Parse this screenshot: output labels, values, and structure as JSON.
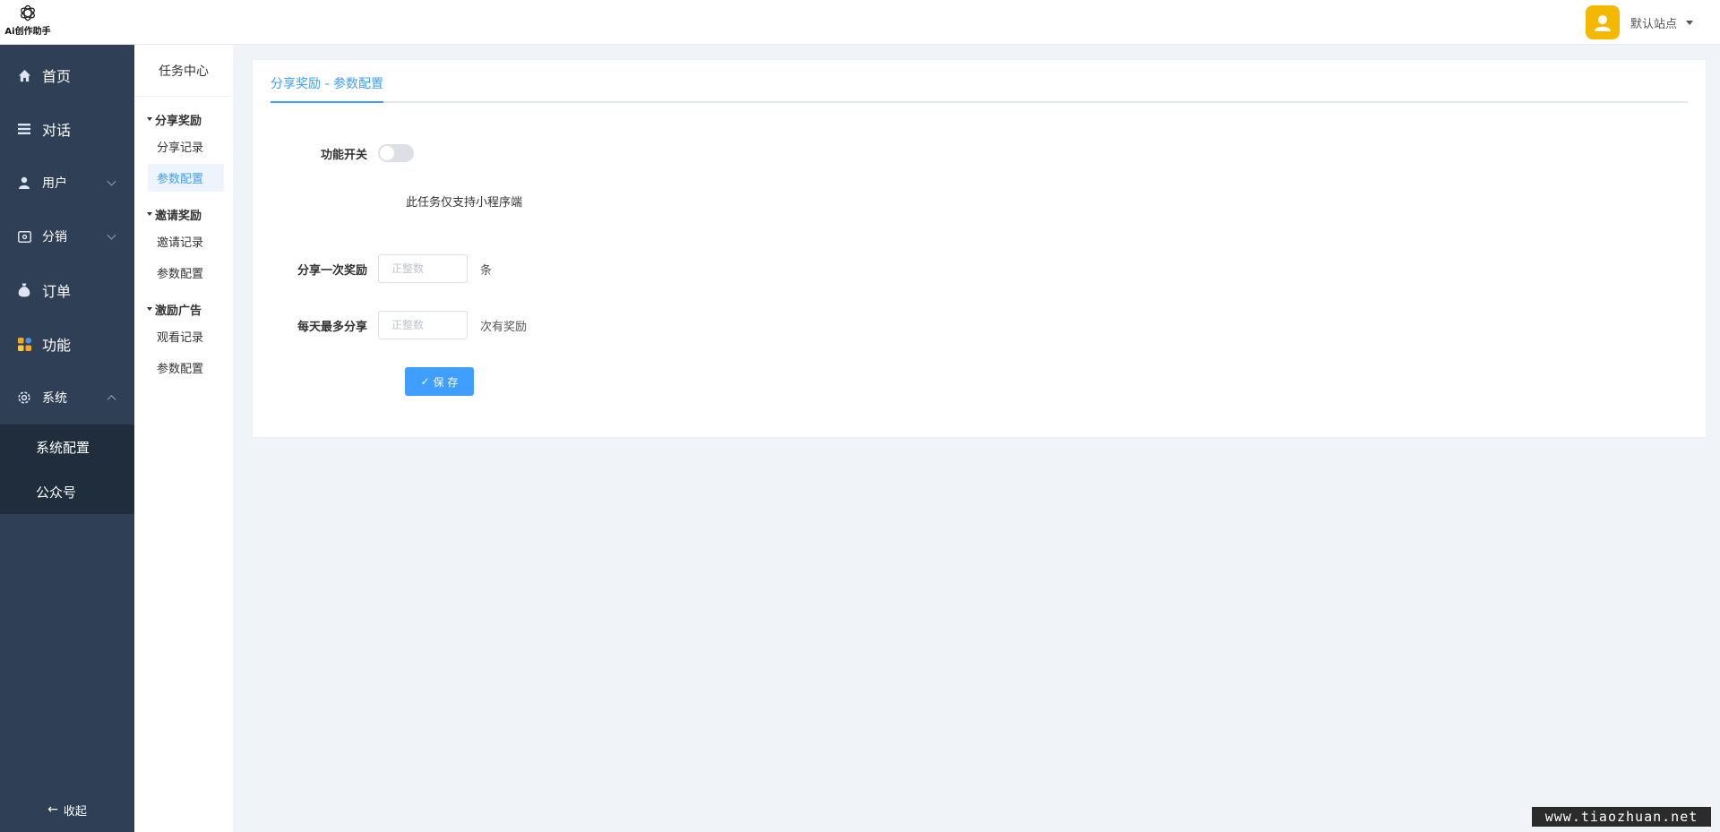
{
  "header": {
    "logo_text": "Ai创作助手",
    "site_selector": "默认站点"
  },
  "sidebar": {
    "items": [
      {
        "label": "首页",
        "icon": "home-icon"
      },
      {
        "label": "对话",
        "icon": "menu-lines-icon"
      },
      {
        "label": "用户",
        "icon": "user-icon",
        "expandable": true
      },
      {
        "label": "分销",
        "icon": "wallet-icon",
        "expandable": true
      },
      {
        "label": "订单",
        "icon": "money-bag-icon"
      },
      {
        "label": "功能",
        "icon": "apps-grid-icon"
      },
      {
        "label": "系统",
        "icon": "gear-icon",
        "expanded": true
      }
    ],
    "system_children": [
      "系统配置",
      "公众号"
    ],
    "collapse_label": "收起"
  },
  "subsidebar": {
    "title": "任务中心",
    "groups": [
      {
        "title": "分享奖励",
        "items": [
          "分享记录",
          "参数配置"
        ]
      },
      {
        "title": "邀请奖励",
        "items": [
          "邀请记录",
          "参数配置"
        ]
      },
      {
        "title": "激励广告",
        "items": [
          "观看记录",
          "参数配置"
        ]
      }
    ],
    "active": "分享奖励 > 参数配置"
  },
  "main": {
    "tab_label": "分享奖励 - 参数配置",
    "form": {
      "switch_label": "功能开关",
      "switch_on": false,
      "notice": "此任务仅支持小程序端",
      "reward_label": "分享一次奖励",
      "reward_placeholder": "正整数",
      "reward_value": "",
      "reward_suffix": "条",
      "max_label": "每天最多分享",
      "max_placeholder": "正整数",
      "max_value": "",
      "max_suffix": "次有奖励",
      "save_label": "保 存"
    }
  },
  "watermark": "www.tiaozhuan.net",
  "colors": {
    "sidebar_bg": "#2f3f55",
    "sidebar_sub_bg": "#1f2d3d",
    "accent": "#409eff",
    "avatar_bg": "#f5b800"
  }
}
